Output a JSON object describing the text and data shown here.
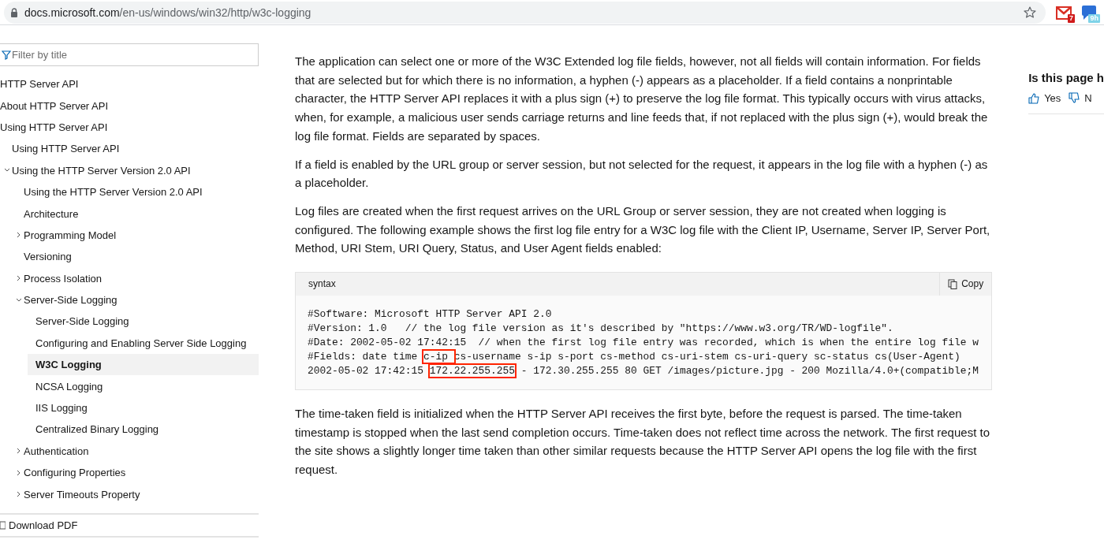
{
  "browser": {
    "url_host": "docs.microsoft.com",
    "url_path": "/en-us/windows/win32/http/w3c-logging",
    "extensions": [
      {
        "kind": "mail",
        "badge": "7"
      },
      {
        "kind": "chat",
        "badge": "9h"
      }
    ]
  },
  "sidebar": {
    "filter": {
      "placeholder": "Filter by title"
    },
    "items": [
      {
        "label": "HTTP Server API",
        "selected": false
      },
      {
        "label": "About HTTP Server API",
        "selected": false
      },
      {
        "label": "Using HTTP Server API",
        "selected": false,
        "children": [
          {
            "label": "Using HTTP Server API",
            "selected": false
          },
          {
            "label": "Using the HTTP Server Version 2.0 API",
            "selected": false,
            "expanded": true,
            "children": [
              {
                "label": "Using the HTTP Server Version 2.0 API",
                "selected": false
              },
              {
                "label": "Architecture",
                "selected": false
              },
              {
                "label": "Programming Model",
                "selected": false,
                "expanded": false
              },
              {
                "label": "Versioning",
                "selected": false
              },
              {
                "label": "Process Isolation",
                "selected": false,
                "expanded": false
              },
              {
                "label": "Server-Side Logging",
                "selected": false,
                "expanded": true,
                "children": [
                  {
                    "label": "Server-Side Logging",
                    "selected": false
                  },
                  {
                    "label": "Configuring and Enabling Server Side Logging",
                    "selected": false
                  },
                  {
                    "label": "W3C Logging",
                    "selected": true
                  },
                  {
                    "label": "NCSA Logging",
                    "selected": false
                  },
                  {
                    "label": "IIS Logging",
                    "selected": false
                  },
                  {
                    "label": "Centralized Binary Logging",
                    "selected": false
                  }
                ]
              },
              {
                "label": "Authentication",
                "selected": false,
                "expanded": false
              },
              {
                "label": "Configuring Properties",
                "selected": false,
                "expanded": false
              },
              {
                "label": "Server Timeouts Property",
                "selected": false,
                "expanded": false
              }
            ]
          }
        ]
      }
    ],
    "download": "Download PDF"
  },
  "article": {
    "paragraphs_before": [
      "The application can select one or more of the W3C Extended log file fields, however, not all fields will contain information. For fields that are selected but for which there is no information, a hyphen (-) appears as a placeholder. If a field contains a nonprintable character, the HTTP Server API replaces it with a plus sign (+) to preserve the log file format. This typically occurs with virus attacks, when, for example, a malicious user sends carriage returns and line feeds that, if not replaced with the plus sign (+), would break the log file format. Fields are separated by spaces.",
      "If a field is enabled by the URL group or server session, but not selected for the request, it appears in the log file with a hyphen (-) as a placeholder.",
      "Log files are created when the first request arrives on the URL Group or server session, they are not created when logging is configured. The following example shows the first log file entry for a W3C log file with the Client IP, Username, Server IP, Server Port, Method, URI Stem, URI Query, Status, and User Agent fields enabled:"
    ],
    "code": {
      "language": "syntax",
      "copy": "Copy",
      "lines": [
        [
          {
            "text": "#Software: Microsoft HTTP Server API 2.0",
            "highlighted": false
          }
        ],
        [
          {
            "text": "#Version: 1.0   // the log file version as it's described by \"https://www.w3.org/TR/WD-logfile\".",
            "highlighted": false
          }
        ],
        [
          {
            "text": "#Date: 2002-05-02 17:42:15  // when the first log file entry was recorded, which is when the entire log file w",
            "highlighted": false
          }
        ],
        [
          {
            "text": "#Fields: date time ",
            "highlighted": false
          },
          {
            "text": "c-ip ",
            "highlighted": true
          },
          {
            "text": "cs-username s-ip s-port cs-method cs-uri-stem cs-uri-query sc-status cs(User-Agent)",
            "highlighted": false
          }
        ],
        [
          {
            "text": "2002-05-02 17:42:15 ",
            "highlighted": false
          },
          {
            "text": "172.22.255.255",
            "highlighted": true
          },
          {
            "text": " - 172.30.255.255 80 GET /images/picture.jpg - 200 Mozilla/4.0+(compatible;M",
            "highlighted": false
          }
        ]
      ]
    },
    "paragraphs_after": [
      "The time-taken field is initialized when the HTTP Server API receives the first byte, before the request is parsed. The time-taken timestamp is stopped when the last send completion occurs. Time-taken does not reflect time across the network. The first request to the site shows a slightly longer time taken than other similar requests because the HTTP Server API opens the log file with the first request."
    ]
  },
  "feedback": {
    "question": "Is this page h",
    "yes": "Yes",
    "no": "N"
  }
}
